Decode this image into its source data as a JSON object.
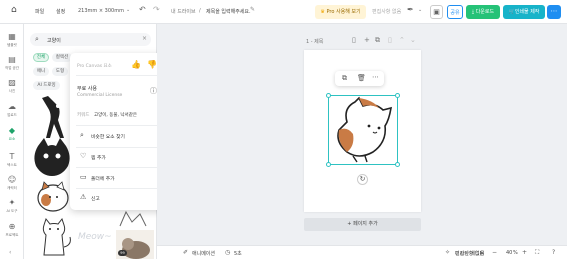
{
  "topbar": {
    "file_label": "파일",
    "settings_label": "설정",
    "size_label": "213mm × 300mm",
    "breadcrumb_drive": "내 드라이브",
    "doc_title": "제목을 입력해주세요.",
    "pro_label": "Pro 사용해 보기",
    "ai_label": "편집사항 없음",
    "share_label": "공유",
    "download_label": "다운로드",
    "print_label": "인쇄물 제작"
  },
  "rail": {
    "items": [
      {
        "label": "템플릿",
        "icon": "template-icon"
      },
      {
        "label": "작업 공간",
        "icon": "workspace-icon"
      },
      {
        "label": "사진",
        "icon": "photo-icon"
      },
      {
        "label": "업로드",
        "icon": "upload-icon"
      },
      {
        "label": "요소",
        "icon": "elements-icon"
      },
      {
        "label": "텍스트",
        "icon": "text-icon"
      },
      {
        "label": "캐릭터",
        "icon": "character-icon"
      },
      {
        "label": "AI 도구",
        "icon": "ai-tools-icon"
      },
      {
        "label": "프로젝트",
        "icon": "projects-icon"
      }
    ],
    "active_index": 4
  },
  "panel": {
    "search_value": "고양이",
    "chips": [
      "전체",
      "컬렉션",
      "애니",
      "도형",
      "AI 드로잉"
    ],
    "watermark_text": "Meow~"
  },
  "menu": {
    "plan_label": "PRO",
    "plan_desc": "Pro Canvas 요소",
    "license_title": "무료 사용",
    "license_sub": "Commercial License",
    "keywords_label": "키워드",
    "keywords_value": "고양이, 동물, 낙서같은",
    "items": [
      {
        "label": "비슷한 요소 찾기",
        "icon": "search-icon"
      },
      {
        "label": "찜 추가",
        "icon": "heart-icon"
      },
      {
        "label": "폴더에 추가",
        "icon": "folder-icon"
      },
      {
        "label": "신고",
        "icon": "warning-icon"
      }
    ]
  },
  "page": {
    "label": "1 - 제목",
    "add_page_label": "페이지 추가"
  },
  "bottombar": {
    "animation_label": "애니메이션",
    "time_label": "5초",
    "design_ai_label": "디자인 에디터",
    "zoom_value": "40",
    "zoom_unit": "%",
    "notes_badge": "99"
  },
  "colors": {
    "accent_green": "#1fa36a",
    "download_green": "#25c277",
    "print_teal": "#17b3c9",
    "share_blue": "#1f8ef1",
    "selection": "#2ec2c2"
  }
}
